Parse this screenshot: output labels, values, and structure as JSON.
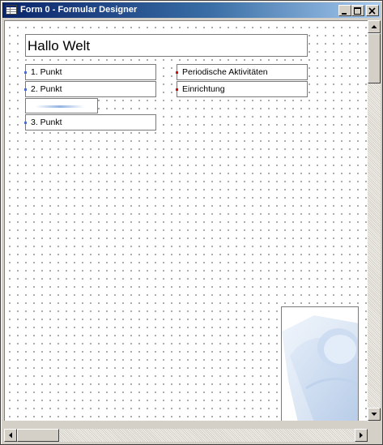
{
  "window": {
    "title": "Form 0 - Formular Designer",
    "icon": "form-grid-icon",
    "controls": [
      "minimize-icon",
      "maximize-icon",
      "close-icon"
    ]
  },
  "form": {
    "heading": "Hallo Welt",
    "left_items": [
      {
        "label": "1. Punkt",
        "marker_color": "#4a6fd0"
      },
      {
        "label": "2. Punkt",
        "marker_color": "#4a6fd0"
      },
      {
        "label": "3. Punkt",
        "marker_color": "#4a6fd0"
      }
    ],
    "right_items": [
      {
        "label": "Periodische Aktivitäten",
        "marker_color": "#d01010"
      },
      {
        "label": "Einrichtung",
        "marker_color": "#d01010"
      }
    ]
  },
  "colors": {
    "titlebar_start": "#0a246a",
    "titlebar_end": "#a6caf0",
    "grid_dots": "#606060"
  }
}
